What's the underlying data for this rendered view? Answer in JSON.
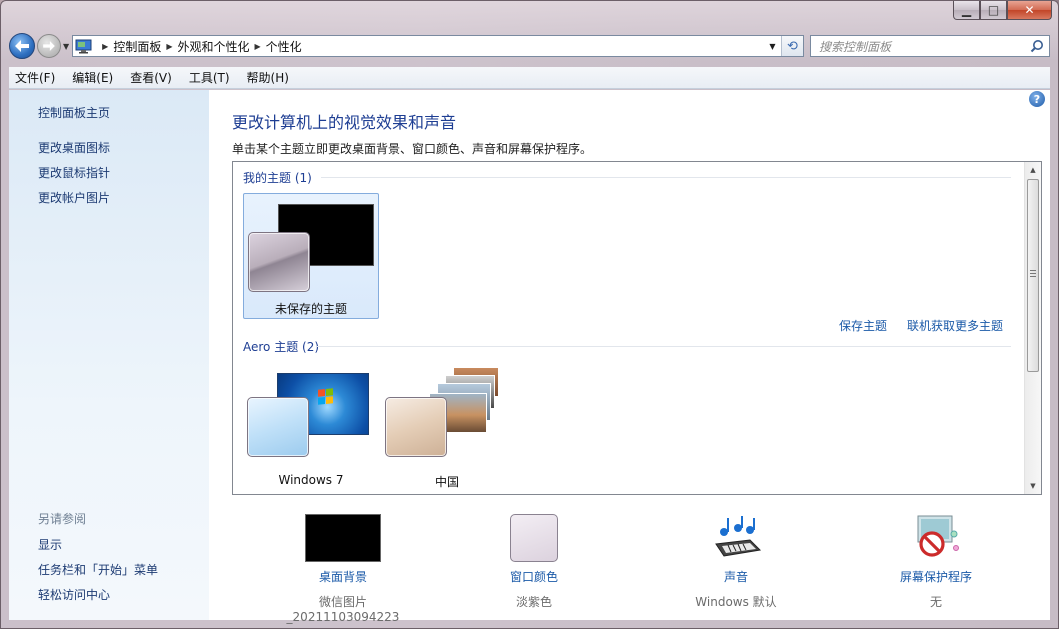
{
  "window": {
    "caption": {
      "minimize": "▁",
      "maximize": "□",
      "close": "✕"
    }
  },
  "navbar": {
    "breadcrumb": [
      "控制面板",
      "外观和个性化",
      "个性化"
    ],
    "search_placeholder": "搜索控制面板"
  },
  "menubar": {
    "items": [
      "文件(F)",
      "编辑(E)",
      "查看(V)",
      "工具(T)",
      "帮助(H)"
    ]
  },
  "sidebar": {
    "home": "控制面板主页",
    "links": [
      "更改桌面图标",
      "更改鼠标指针",
      "更改帐户图片"
    ],
    "see_also_heading": "另请参阅",
    "see_also": [
      "显示",
      "任务栏和「开始」菜单",
      "轻松访问中心"
    ]
  },
  "main": {
    "title": "更改计算机上的视觉效果和声音",
    "description": "单击某个主题立即更改桌面背景、窗口颜色、声音和屏幕保护程序。",
    "my_themes_heading": "我的主题 (1)",
    "my_themes": [
      {
        "label": "未保存的主题"
      }
    ],
    "save_theme": "保存主题",
    "get_more_online": "联机获取更多主题",
    "aero_heading": "Aero 主题 (2)",
    "aero_themes": [
      {
        "label": "Windows 7"
      },
      {
        "label": "中国"
      }
    ],
    "scrollbar": {
      "up": "▲",
      "down": "▼"
    }
  },
  "settings": [
    {
      "link": "桌面背景",
      "value": "微信图片_20211103094223",
      "icon": "desktop-background-icon"
    },
    {
      "link": "窗口颜色",
      "value": "淡紫色",
      "icon": "window-color-icon"
    },
    {
      "link": "声音",
      "value": "Windows 默认",
      "icon": "sound-icon"
    },
    {
      "link": "屏幕保护程序",
      "value": "无",
      "icon": "screensaver-icon"
    }
  ],
  "colors": {
    "accent_link": "#1b5aa8",
    "title_blue": "#1e3e93",
    "window_color_swatch": "#e6dde8"
  }
}
